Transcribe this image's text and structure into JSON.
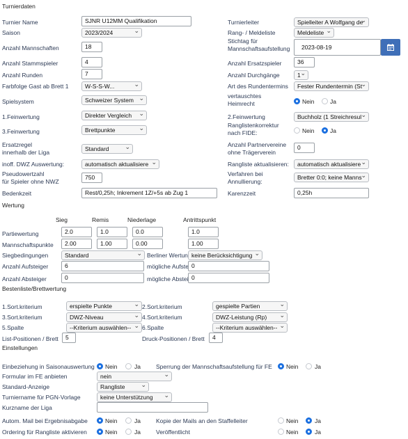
{
  "sections": {
    "turnierdaten": "Turnierdaten",
    "wertung": "Wertung",
    "bestenliste": "Bestenliste/Brettwertung",
    "einstellungen": "Einstellungen"
  },
  "left": {
    "turniername": {
      "label": "Turnier Name",
      "value": "SJNR U12MM Qualifikation"
    },
    "saison": {
      "label": "Saison",
      "value": "2023/2024"
    },
    "mannschaften": {
      "label": "Anzahl Mannschaften",
      "value": "18"
    },
    "stammspieler": {
      "label": "Anzahl Stammspieler",
      "value": "4"
    },
    "runden": {
      "label": "Anzahl Runden",
      "value": "7"
    },
    "farbfolge": {
      "label": "Farbfolge Gast ab Brett 1",
      "value": "W-S-S-W..."
    },
    "spielsystem": {
      "label": "Spielsystem",
      "value": "Schweizer System"
    },
    "feinwertung1": {
      "label": "1.Feinwertung",
      "value": "Direkter Vergleich"
    },
    "feinwertung3": {
      "label": "3.Feinwertung",
      "value": "Brettpunkte"
    },
    "ersatzregel": {
      "label1": "Ersatzregel",
      "label2": "innerhalb der Liga",
      "value": "Standard"
    },
    "dwz": {
      "label": "inoff. DWZ Auswertung:",
      "value": "automatisch aktualisiere"
    },
    "pseudowert": {
      "label1": "Pseudowertzahl",
      "label2": "für Spieler ohne NWZ",
      "value": "750"
    },
    "bedenkzeit": {
      "label": "Bedenkzeit",
      "value": "Rest/0,25h; Inkrement 1Z/+5s ab Zug 1"
    }
  },
  "right": {
    "turnierleiter": {
      "label": "Turnierleiter",
      "value": "Spielleiter A Wolfgang de"
    },
    "rangliste": {
      "label": "Rang- / Meldeliste",
      "value": "Meldeliste"
    },
    "stichtag": {
      "label1": "Stichtag für",
      "label2": "Mannschaftsaufstellung",
      "value": "2023-08-19"
    },
    "ersatzspieler": {
      "label": "Anzahl Ersatzspieler",
      "value": "36"
    },
    "durchgaenge": {
      "label": "Anzahl Durchgänge",
      "value": "1"
    },
    "rundentermin": {
      "label": "Art des Rundentermins",
      "value": "Fester Rundentermin (St"
    },
    "heimrecht": {
      "label1": "vertauschtes",
      "label2": "Heimrecht",
      "opt_nein": "Nein",
      "opt_ja": "Ja"
    },
    "feinwertung2": {
      "label": "2.Feinwertung",
      "value": "Buchholz (1 Streichresul"
    },
    "ranglistenkorrektur": {
      "label1": "Ranglistenkorrektur",
      "label2": "nach FIDE:",
      "opt_nein": "Nein",
      "opt_ja": "Ja"
    },
    "partnervereine": {
      "label1": "Anzahl Partnervereine",
      "label2": "ohne Trägerverein",
      "value": "0"
    },
    "rangliste_akt": {
      "label": "Rangliste aktualisieren:",
      "value": "automatisch aktualisiere"
    },
    "annullierung": {
      "label1": "Verfahren bei",
      "label2": "Annullierung:",
      "value": "Bretter 0:0; keine Manns"
    },
    "karenzzeit": {
      "label": "Karenzzeit",
      "value": "0,25h"
    }
  },
  "wertung": {
    "headers": [
      "Sieg",
      "Remis",
      "Niederlage",
      "Antrittspunkt"
    ],
    "partiewertung": {
      "label": "Partiewertung",
      "values": [
        "2.0",
        "1.0",
        "0.0",
        "1.0"
      ]
    },
    "mannschaftspunkte": {
      "label": "Mannschaftspunkte",
      "values": [
        "2.00",
        "1.00",
        "0.00",
        "1.00"
      ]
    },
    "siegbedingungen": {
      "label": "Siegbedingungen",
      "value": "Standard"
    },
    "berliner": {
      "label": "Berliner Wertung",
      "value": "keine Berücksichtigung"
    },
    "aufsteiger": {
      "label": "Anzahl Aufsteiger",
      "value": "6"
    },
    "moegl_aufsteiger": {
      "label": "mögliche Aufsteiger",
      "value": "0"
    },
    "absteiger": {
      "label": "Anzahl Absteiger",
      "value": "0"
    },
    "moegl_absteiger": {
      "label": "mögliche Absteiger",
      "value": "0"
    }
  },
  "bestenliste": {
    "sort1": {
      "label": "1.Sort.kriterium",
      "value": "erspielte Punkte"
    },
    "sort2": {
      "label": "2.Sort.kriterium",
      "value": "gespielte Partien"
    },
    "sort3": {
      "label": "3.Sort.kriterium",
      "value": "DWZ-Niveau"
    },
    "sort4": {
      "label": "4.Sort.kriterium",
      "value": "DWZ-Leistung (Rp)"
    },
    "spalte5": {
      "label": "5.Spalte",
      "value": "--Kriterium auswählen--"
    },
    "spalte6": {
      "label": "6.Spalte",
      "value": "--Kriterium auswählen--"
    },
    "listpos": {
      "label": "List-Positionen / Brett",
      "value": "5"
    },
    "druckpos": {
      "label": "Druck-Positionen / Brett",
      "value": "4"
    }
  },
  "einstellungen": {
    "saisonauswertung": {
      "label": "Einbeziehung in Saisonauswertung",
      "opt_nein": "Nein",
      "opt_ja": "Ja"
    },
    "sperrung": {
      "label": "Sperrung der Mannschaftsaufstellung für FE",
      "opt_nein": "Nein",
      "opt_ja": "Ja"
    },
    "formular": {
      "label": "Formular im FE anbieten",
      "value": "nein"
    },
    "standardanzeige": {
      "label": "Standard-Anzeige",
      "value": "Rangliste"
    },
    "pgn": {
      "label": "Turniername für PGN-Vorlage",
      "value": "keine Unterstützung"
    },
    "kurzname": {
      "label": "Kurzname der Liga",
      "value": ""
    },
    "automail": {
      "label": "Autom. Mail bei Ergebnisabgabe",
      "opt_nein": "Nein",
      "opt_ja": "Ja"
    },
    "kopie": {
      "label": "Kopie der Mails an den Staffelleiter",
      "opt_nein": "Nein",
      "opt_ja": "Ja"
    },
    "ordering": {
      "label": "Ordering für Rangliste aktivieren",
      "opt_nein": "Nein",
      "opt_ja": "Ja"
    },
    "veroeffentlicht": {
      "label": "Veröffentlicht",
      "opt_nein": "Nein",
      "opt_ja": "Ja"
    }
  },
  "icons": {
    "calendar": "calendar-icon"
  },
  "colors": {
    "accent": "#1a6fe0",
    "calendar_button": "#3f6fb8"
  }
}
